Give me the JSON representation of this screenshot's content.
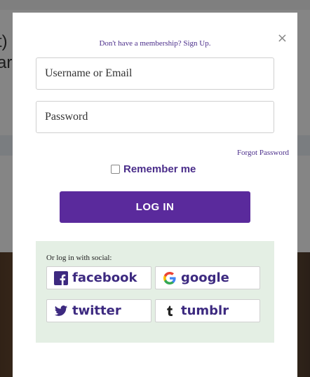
{
  "background": {
    "fragment_line_1": "t)",
    "fragment_line_2": "are"
  },
  "modal": {
    "signup_text": "Don't have a membership? Sign Up.",
    "close_glyph": "×",
    "username_placeholder": "Username or Email",
    "password_placeholder": "Password",
    "forgot_password": "Forgot Password",
    "remember_me": "Remember me",
    "login_label": "LOG IN"
  },
  "social": {
    "title": "Or log in with social:",
    "buttons": [
      {
        "label": "facebook",
        "icon": "facebook-icon"
      },
      {
        "label": "google",
        "icon": "google-icon"
      },
      {
        "label": "twitter",
        "icon": "twitter-icon"
      },
      {
        "label": "tumblr",
        "icon": "tumblr-icon"
      }
    ]
  },
  "colors": {
    "brand_purple": "#5a2a9c",
    "link_purple": "#4a2d8a",
    "social_panel": "#e4efe4",
    "facebook": "#3b5998",
    "twitter": "#1da1f2"
  }
}
